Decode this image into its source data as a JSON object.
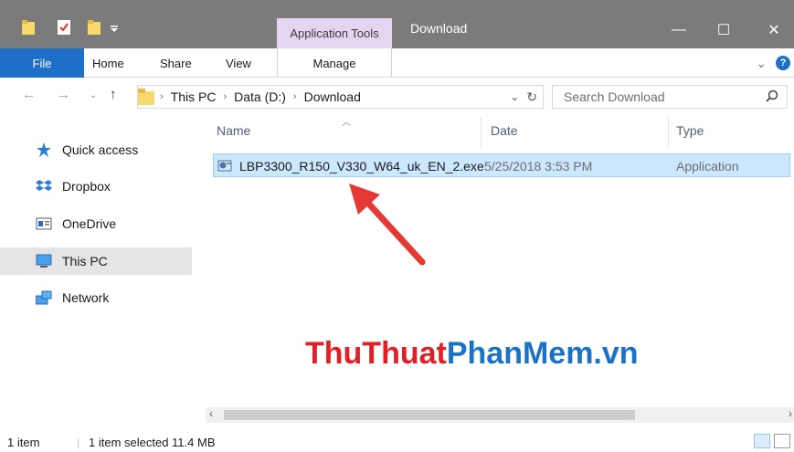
{
  "titlebar": {
    "context_tab": "Application Tools",
    "title": "Download",
    "buttons": {
      "minimize": "—",
      "maximize": "☐",
      "close": "✕"
    }
  },
  "ribbon": {
    "tabs": [
      "File",
      "Home",
      "Share",
      "View",
      "Manage"
    ],
    "expand": "⌄",
    "help": "?"
  },
  "address": {
    "crumbs": [
      "This PC",
      "Data (D:)",
      "Download"
    ],
    "dropdown": "⌄",
    "refresh": "↻"
  },
  "search": {
    "placeholder": "Search Download"
  },
  "sidebar": {
    "items": [
      {
        "label": "Quick access",
        "icon": "star-icon"
      },
      {
        "label": "Dropbox",
        "icon": "dropbox-icon"
      },
      {
        "label": "OneDrive",
        "icon": "onedrive-icon"
      },
      {
        "label": "This PC",
        "icon": "computer-icon"
      },
      {
        "label": "Network",
        "icon": "network-icon"
      }
    ]
  },
  "columns": {
    "name": "Name",
    "date": "Date",
    "type": "Type"
  },
  "files": [
    {
      "name": "LBP3300_R150_V330_W64_uk_EN_2.exe",
      "date": "5/25/2018 3:53 PM",
      "type": "Application"
    }
  ],
  "watermark": {
    "part1": "ThuThuat",
    "part2": "PhanMem.vn"
  },
  "status": {
    "count": "1 item",
    "selected": "1 item selected  11.4 MB"
  },
  "colors": {
    "accent": "#1e6fc7",
    "selection": "#cce8ff",
    "context_tab": "#e4d6f2",
    "arrow": "#e53935"
  }
}
